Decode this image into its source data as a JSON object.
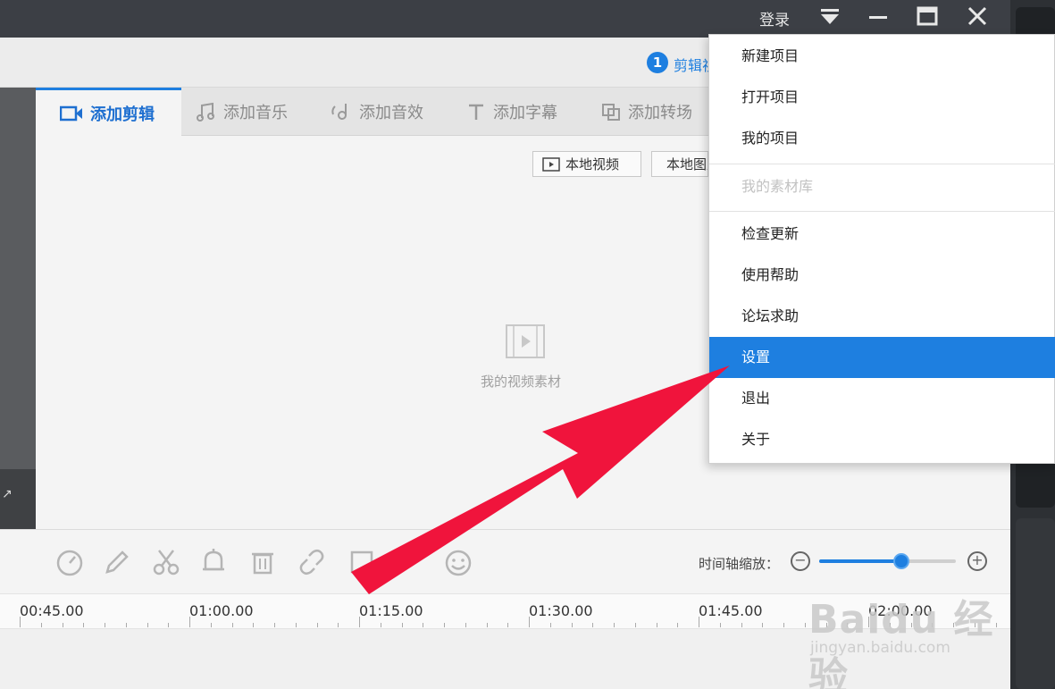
{
  "titlebar": {
    "login_label": "登录"
  },
  "steps": {
    "badge": "1",
    "label": "剪辑视频"
  },
  "tabs": [
    {
      "label": "添加剪辑",
      "icon": "video-camera-icon",
      "active": true
    },
    {
      "label": "添加音乐",
      "icon": "music-note-icon",
      "active": false
    },
    {
      "label": "添加音效",
      "icon": "sound-effect-icon",
      "active": false
    },
    {
      "label": "添加字幕",
      "icon": "text-t-icon",
      "active": false
    },
    {
      "label": "添加转场",
      "icon": "transition-icon",
      "active": false
    }
  ],
  "sources": {
    "local_video": "本地视频",
    "local_image": "本地图片"
  },
  "library": {
    "empty_label": "我的视频素材"
  },
  "toolbar": {
    "zoom_label": "时间轴缩放：",
    "zoom_level": 0.6,
    "tools": [
      "speed-icon",
      "edit-pencil-icon",
      "scissors-icon",
      "bell-icon",
      "trash-icon",
      "unlink-icon",
      "crop-icon",
      "sticker-icon",
      "emoji-icon"
    ]
  },
  "timeline": {
    "ticks": [
      "00:45.00",
      "01:00.00",
      "01:15.00",
      "01:30.00",
      "01:45.00",
      "02:00.00"
    ]
  },
  "menu": {
    "items": [
      {
        "label": "新建项目",
        "enabled": true
      },
      {
        "label": "打开项目",
        "enabled": true
      },
      {
        "label": "我的项目",
        "enabled": true
      },
      {
        "label": "我的素材库",
        "enabled": false
      },
      {
        "label": "检查更新",
        "enabled": true
      },
      {
        "label": "使用帮助",
        "enabled": true
      },
      {
        "label": "论坛求助",
        "enabled": true
      },
      {
        "label": "设置",
        "enabled": true,
        "highlighted": true
      },
      {
        "label": "退出",
        "enabled": true
      },
      {
        "label": "关于",
        "enabled": true
      }
    ]
  },
  "watermark": {
    "brand": "Baidu 经验",
    "url": "jingyan.baidu.com"
  },
  "colors": {
    "accent": "#1e7fe0",
    "arrow": "#f0143c",
    "titlebar": "#3c3f45"
  }
}
